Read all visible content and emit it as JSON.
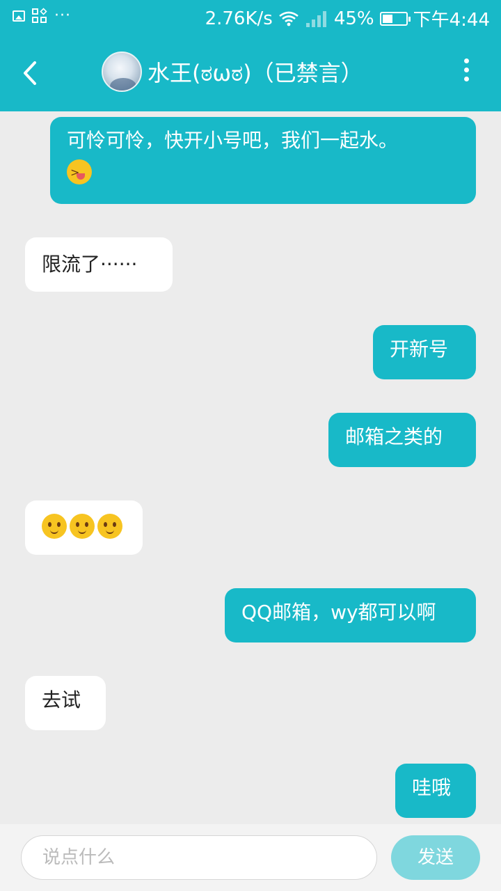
{
  "colors": {
    "accent": "#18b9c8",
    "incoming_bg": "#ffffff",
    "background": "#ececec"
  },
  "status_bar": {
    "left_icons": [
      "image-icon",
      "apps-icon",
      "more-dots-icon"
    ],
    "dots": "···",
    "net_speed": "2.76K/s",
    "battery_percent": "45%",
    "battery_level": 0.45,
    "time": "下午4:44"
  },
  "header": {
    "title": "水王(ಠωಠ)（已禁言）",
    "back_icon": "chevron-left-icon",
    "more_icon": "more-vertical-icon"
  },
  "messages": [
    {
      "direction": "out",
      "text": "可怜可怜，快开小号吧，我们一起水。",
      "emoji": [
        "squinting-tongue-emoji"
      ]
    },
    {
      "direction": "in",
      "text": "限流了······"
    },
    {
      "direction": "out",
      "text": "开新号"
    },
    {
      "direction": "out",
      "text": "邮箱之类的"
    },
    {
      "direction": "in",
      "text": "",
      "emoji": [
        "smiling-face-emoji",
        "smiling-face-emoji",
        "smiling-face-emoji"
      ]
    },
    {
      "direction": "out",
      "text": "QQ邮箱，wy都可以啊"
    },
    {
      "direction": "in",
      "text": "去试"
    },
    {
      "direction": "out",
      "text": "哇哦"
    }
  ],
  "input": {
    "placeholder": "说点什么",
    "value": ""
  },
  "send_button": {
    "label": "发送"
  }
}
